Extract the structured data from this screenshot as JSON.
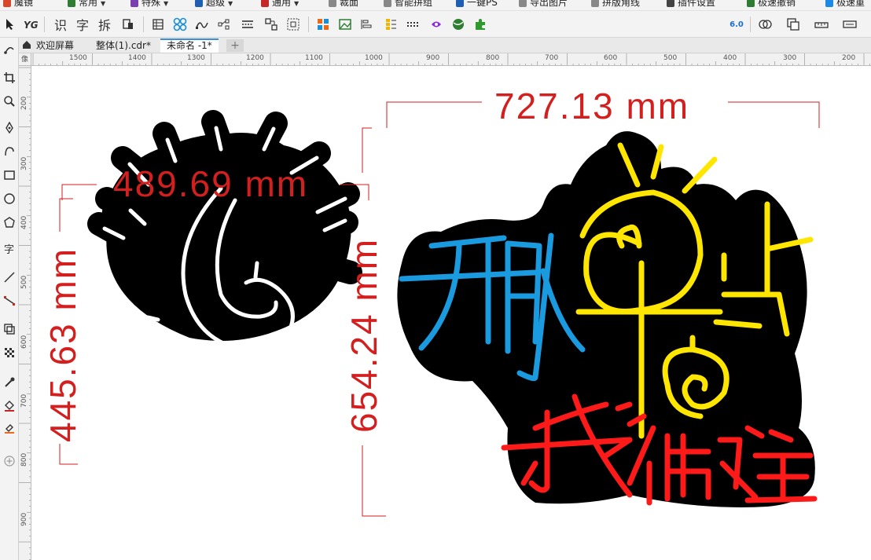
{
  "menu": {
    "items": [
      {
        "label": "魔镜",
        "color": "#d9472b"
      },
      {
        "label": "常用",
        "color": "#2e7d32"
      },
      {
        "label": "特殊",
        "color": "#7b3fb0"
      },
      {
        "label": "超级",
        "color": "#1e5fb4"
      },
      {
        "label": "通用",
        "color": "#c62828"
      },
      {
        "label": "裁面",
        "color": "#444444"
      },
      {
        "label": "智能拼组",
        "color": "#444444"
      },
      {
        "label": "一键PS",
        "color": "#1e5fb4"
      },
      {
        "label": "导出图片",
        "color": "#444444"
      },
      {
        "label": "拼版角线",
        "color": "#444444"
      },
      {
        "label": "插件设置",
        "color": "#444444"
      },
      {
        "label": "极速撤销",
        "color": "#2e7d32"
      },
      {
        "label": "极速重",
        "color": "#1e88e5"
      }
    ]
  },
  "toolbar": {
    "ocr_label": "识",
    "char_label": "字",
    "split_label": "拆",
    "version_label": "6.0"
  },
  "tabs": [
    {
      "label": "欢迎屏幕"
    },
    {
      "label": "整体(1).cdr*"
    },
    {
      "label": "未命名 -1*"
    }
  ],
  "tab_add_label": "+",
  "ruler": {
    "corner_label": "像",
    "h_labels": [
      "1500",
      "1400",
      "1300",
      "1200",
      "1100",
      "1000",
      "900",
      "800",
      "700",
      "600",
      "500",
      "400",
      "300",
      "200"
    ],
    "v_labels": [
      "200",
      "300",
      "400",
      "500",
      "600",
      "700",
      "800",
      "900"
    ]
  },
  "artwork": {
    "dim_width_left": "489.69 mm",
    "dim_height_left": "445.63 mm",
    "dim_width_right": "727.13 mm",
    "dim_height_right": "654.24 mm",
    "text_blue": "开的",
    "text_yellow": "早点",
    "text_red": "我做主",
    "colors": {
      "dimension": "#d41f1f",
      "blue": "#1a9be0",
      "yellow": "#ffe600",
      "red": "#ff1a1a",
      "white_stroke": "#ffffff",
      "body": "#000000"
    }
  }
}
